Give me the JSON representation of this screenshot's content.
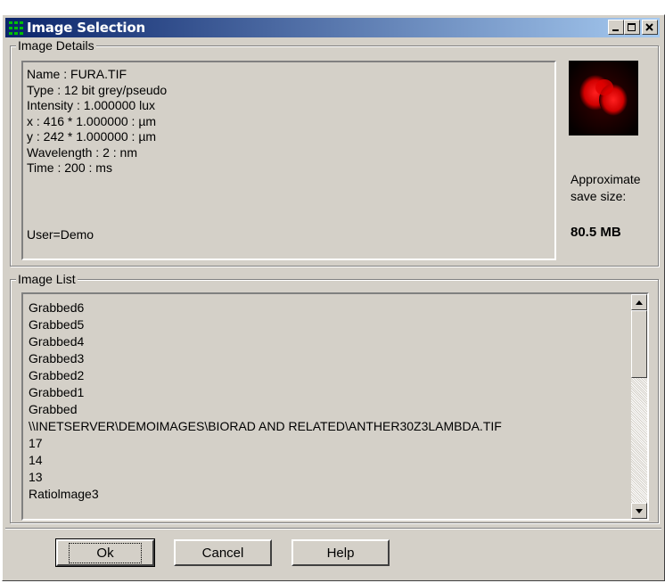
{
  "window": {
    "title": "Image Selection",
    "controls": [
      "minimize-icon",
      "maximize-icon",
      "close-icon"
    ]
  },
  "details": {
    "group_label": "Image Details",
    "lines": [
      "Name : FURA.TIF",
      "Type : 12 bit grey/pseudo",
      "Intensity : 1.000000 lux",
      "x : 416 * 1.000000 : µm",
      "y : 242 * 1.000000 : µm",
      "Wavelength : 2 : nm",
      "Time : 200 : ms"
    ],
    "user": "User=Demo",
    "save_size_label_1": "Approximate",
    "save_size_label_2": "save size:",
    "save_size_value": "80.5 MB"
  },
  "image_list": {
    "group_label": "Image List",
    "items": [
      "Grabbed6",
      "Grabbed5",
      "Grabbed4",
      "Grabbed3",
      "Grabbed2",
      "Grabbed1",
      "Grabbed",
      "\\\\INETSERVER\\DEMOIMAGES\\BIORAD AND RELATED\\ANTHER30Z3LAMBDA.TIF",
      "17",
      "14",
      "13",
      "Ratiolmage3"
    ]
  },
  "buttons": {
    "ok": "Ok",
    "cancel": "Cancel",
    "help": "Help"
  },
  "colors": {
    "title_start": "#0a246a",
    "title_end": "#a6caf0",
    "face": "#d4d0c8"
  }
}
